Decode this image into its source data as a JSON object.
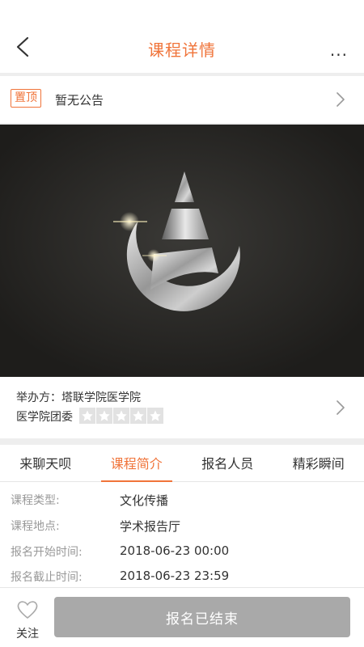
{
  "header": {
    "title": "课程详情",
    "back_icon": "chevron-left-icon",
    "more_label": "...",
    "title_color": "#f0743a"
  },
  "notice": {
    "tag": "置顶",
    "text": "暂无公告",
    "chevron_icon": "chevron-right-icon"
  },
  "hero": {
    "image_icon": "course-logo-icon"
  },
  "organizer": {
    "line1": "举办方：塔联学院医学院",
    "line2": "医学院团委",
    "rating": 0,
    "rating_max": 5,
    "chevron_icon": "chevron-right-icon"
  },
  "tabs": [
    {
      "label": "来聊天呗",
      "active": false
    },
    {
      "label": "课程简介",
      "active": true
    },
    {
      "label": "报名人员",
      "active": false
    },
    {
      "label": "精彩瞬间",
      "active": false
    }
  ],
  "info": [
    {
      "label": "课程类型:",
      "value": "文化传播"
    },
    {
      "label": "课程地点:",
      "value": "学术报告厅"
    },
    {
      "label": "报名开始时间:",
      "value": "2018-06-23 00:00"
    },
    {
      "label": "报名截止时间:",
      "value": "2018-06-23 23:59"
    }
  ],
  "bottom": {
    "follow_label": "关注",
    "follow_icon": "heart-icon",
    "signup_label": "报名已结束",
    "signup_color": "#a9a9a9"
  },
  "accent_color": "#f0743a"
}
